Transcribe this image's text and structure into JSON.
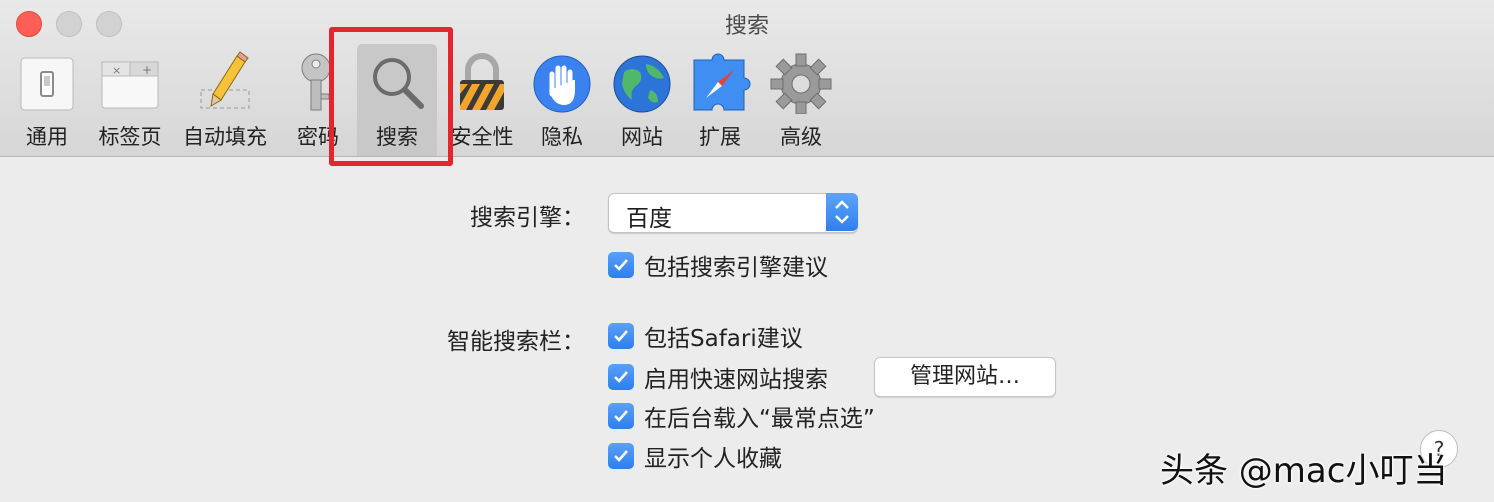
{
  "window": {
    "title": "搜索"
  },
  "toolbar": {
    "tabs": [
      {
        "label": "通用",
        "icon": "general-switch-icon"
      },
      {
        "label": "标签页",
        "icon": "tabs-icon"
      },
      {
        "label": "自动填充",
        "icon": "pencil-icon"
      },
      {
        "label": "密码",
        "icon": "key-icon"
      },
      {
        "label": "搜索",
        "icon": "magnifier-icon",
        "selected": true
      },
      {
        "label": "安全性",
        "icon": "lock-icon"
      },
      {
        "label": "隐私",
        "icon": "hand-icon"
      },
      {
        "label": "网站",
        "icon": "globe-icon"
      },
      {
        "label": "扩展",
        "icon": "compass-puzzle-icon"
      },
      {
        "label": "高级",
        "icon": "gear-icon"
      }
    ]
  },
  "search": {
    "engine_label": "搜索引擎：",
    "engine_value": "百度",
    "include_engine_suggestions": {
      "label": "包括搜索引擎建议",
      "checked": true
    },
    "smart_field_label": "智能搜索栏：",
    "include_safari_suggestions": {
      "label": "包括Safari建议",
      "checked": true
    },
    "quick_website_search": {
      "label": "启用快速网站搜索",
      "checked": true
    },
    "manage_websites_label": "管理网站…",
    "preload_top_hit": {
      "label": "在后台载入“最常点选”",
      "checked": true
    },
    "show_favorites": {
      "label": "显示个人收藏",
      "checked": true
    }
  },
  "help_label": "?",
  "watermark": "头条 @mac小叮当",
  "colors": {
    "accent": "#2f7ff0",
    "highlight_box": "#e5252c",
    "close": "#fd5f57"
  }
}
